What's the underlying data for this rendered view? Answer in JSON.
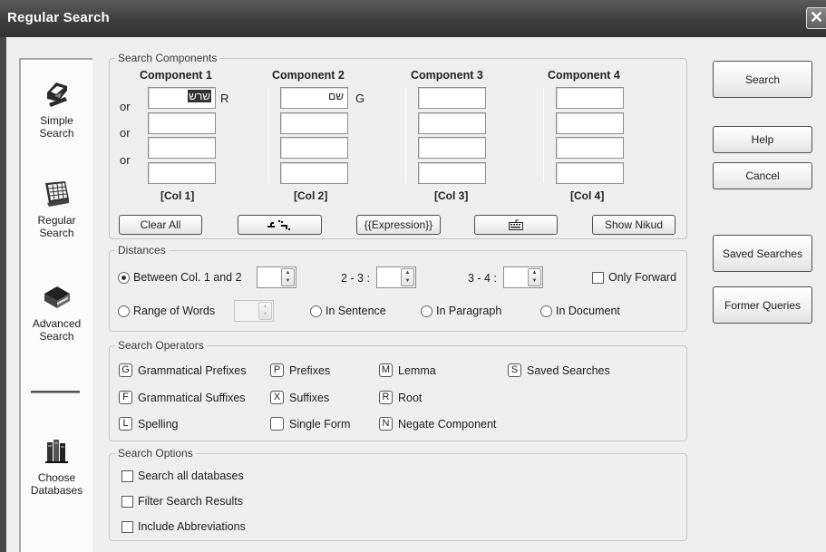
{
  "window": {
    "title": "Regular Search",
    "close_glyph": "✕"
  },
  "nav": {
    "items": [
      {
        "label": "Simple\nSearch",
        "icon": "simple-search-icon"
      },
      {
        "label": "Regular\nSearch",
        "icon": "regular-search-icon"
      },
      {
        "label": "Advanced\nSearch",
        "icon": "advanced-search-icon"
      },
      {
        "label": "Choose\nDatabases",
        "icon": "choose-databases-icon"
      }
    ]
  },
  "components": {
    "legend": "Search Components",
    "or_label": "or",
    "columns": [
      {
        "header": "Component 1",
        "footer": "[Col 1]",
        "first_value": "שרש",
        "suffix": "R"
      },
      {
        "header": "Component 2",
        "footer": "[Col 2]",
        "first_value": "שם",
        "suffix": "G"
      },
      {
        "header": "Component 3",
        "footer": "[Col 3]",
        "first_value": "",
        "suffix": ""
      },
      {
        "header": "Component 4",
        "footer": "[Col 4]",
        "first_value": "",
        "suffix": ""
      }
    ],
    "buttons": {
      "clear_all": "Clear All",
      "expression": "{{Expression}}",
      "show_nikud": "Show Nikud"
    }
  },
  "distances": {
    "legend": "Distances",
    "between": "Between Col. 1 and 2",
    "col23": "2 - 3 :",
    "col34": "3 - 4 :",
    "only_forward": "Only Forward",
    "range_of_words": "Range of Words",
    "in_sentence": "In Sentence",
    "in_paragraph": "In Paragraph",
    "in_document": "In Document",
    "selected": "between"
  },
  "operators": {
    "legend": "Search Operators",
    "items": [
      {
        "key": "G",
        "label": "Grammatical Prefixes"
      },
      {
        "key": "P",
        "label": "Prefixes"
      },
      {
        "key": "M",
        "label": "Lemma"
      },
      {
        "key": "S",
        "label": "Saved Searches"
      },
      {
        "key": "F",
        "label": "Grammatical Suffixes"
      },
      {
        "key": "X",
        "label": "Suffixes"
      },
      {
        "key": "R",
        "label": "Root"
      },
      {
        "key": "L",
        "label": "Spelling"
      },
      {
        "key": "",
        "label": "Single Form"
      },
      {
        "key": "N",
        "label": "Negate Component"
      }
    ]
  },
  "options": {
    "legend": "Search Options",
    "items": [
      "Search all databases",
      "Filter Search Results",
      "Include Abbreviations"
    ]
  },
  "side_buttons": {
    "search": "Search",
    "help": "Help",
    "cancel": "Cancel",
    "saved_searches": "Saved Searches",
    "former_queries": "Former Queries"
  }
}
